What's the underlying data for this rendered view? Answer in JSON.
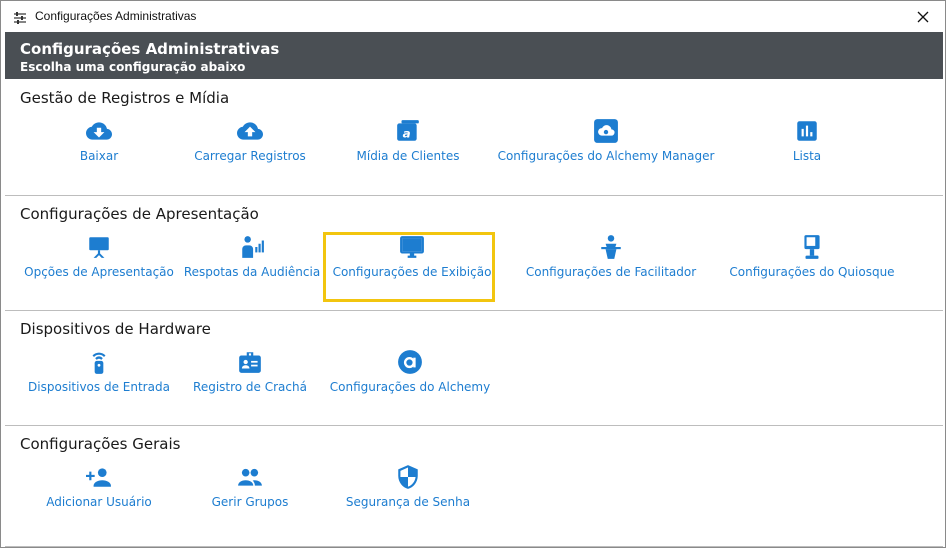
{
  "window": {
    "title": "Configurações Administrativas"
  },
  "header": {
    "title": "Configurações Administrativas",
    "subtitle": "Escolha uma configuração abaixo"
  },
  "sections": [
    {
      "title": "Gestão de Registros e Mídia",
      "items": [
        {
          "label": "Baixar",
          "icon": "cloud-download-icon"
        },
        {
          "label": "Carregar Registros",
          "icon": "cloud-upload-icon"
        },
        {
          "label": "Mídia de Clientes",
          "icon": "media-icon"
        },
        {
          "label": "Configurações do Alchemy Manager",
          "icon": "cloud-settings-icon"
        },
        {
          "label": "Lista",
          "icon": "bar-chart-icon"
        }
      ]
    },
    {
      "title": "Configurações de Apresentação",
      "items": [
        {
          "label": "Opções de Apresentação",
          "icon": "presentation-icon"
        },
        {
          "label": "Respotas da Audiência",
          "icon": "audience-icon"
        },
        {
          "label": "Configurações de Exibição",
          "icon": "monitor-icon"
        },
        {
          "label": "Configurações de Facilitador",
          "icon": "facilitator-icon"
        },
        {
          "label": "Configurações do Quiosque",
          "icon": "kiosk-icon"
        }
      ]
    },
    {
      "title": "Dispositivos de Hardware",
      "items": [
        {
          "label": "Dispositivos de Entrada",
          "icon": "remote-icon"
        },
        {
          "label": "Registro de Crachá",
          "icon": "badge-icon"
        },
        {
          "label": "Configurações do Alchemy",
          "icon": "alchemy-icon"
        }
      ]
    },
    {
      "title": "Configurações Gerais",
      "items": [
        {
          "label": "Adicionar Usuário",
          "icon": "add-user-icon"
        },
        {
          "label": "Gerir Grupos",
          "icon": "group-icon"
        },
        {
          "label": "Segurança de Senha",
          "icon": "shield-icon"
        }
      ]
    }
  ],
  "colors": {
    "accent": "#1d7dd0",
    "header_bg": "#4a4f54",
    "highlight": "#f2c50f"
  }
}
